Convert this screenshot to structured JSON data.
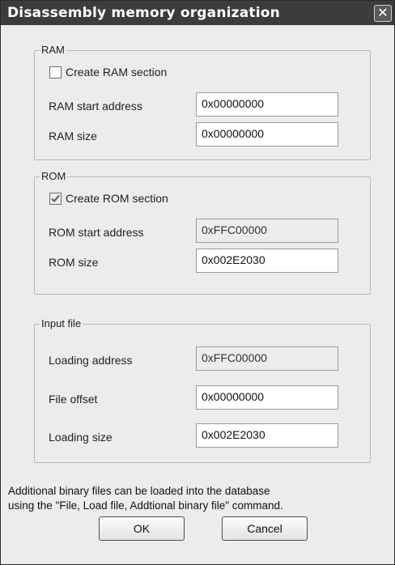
{
  "dialog": {
    "title": "Disassembly memory organization",
    "close_glyph": "✕"
  },
  "ram": {
    "legend": "RAM",
    "checkbox_label": "Create RAM section",
    "checkbox_checked": false,
    "start_label": "RAM start address",
    "start_value": "0x00000000",
    "size_label": "RAM size",
    "size_value": "0x00000000"
  },
  "rom": {
    "legend": "ROM",
    "checkbox_label": "Create ROM section",
    "checkbox_checked": true,
    "start_label": "ROM start address",
    "start_value": "0xFFC00000",
    "size_label": "ROM size",
    "size_value": "0x002E2030"
  },
  "input_file": {
    "legend": "Input file",
    "loading_address_label": "Loading address",
    "loading_address_value": "0xFFC00000",
    "file_offset_label": "File offset",
    "file_offset_value": "0x00000000",
    "loading_size_label": "Loading size",
    "loading_size_value": "0x002E2030"
  },
  "info": {
    "line1": "Additional binary files can be loaded into the database",
    "line2": "using the \"File, Load file, Addtional binary file\" command."
  },
  "buttons": {
    "ok": "OK",
    "cancel": "Cancel"
  },
  "colors": {
    "titlebar": "#3c3c3c",
    "dialog_bg": "#ececec",
    "field_bg": "#ffffff"
  }
}
